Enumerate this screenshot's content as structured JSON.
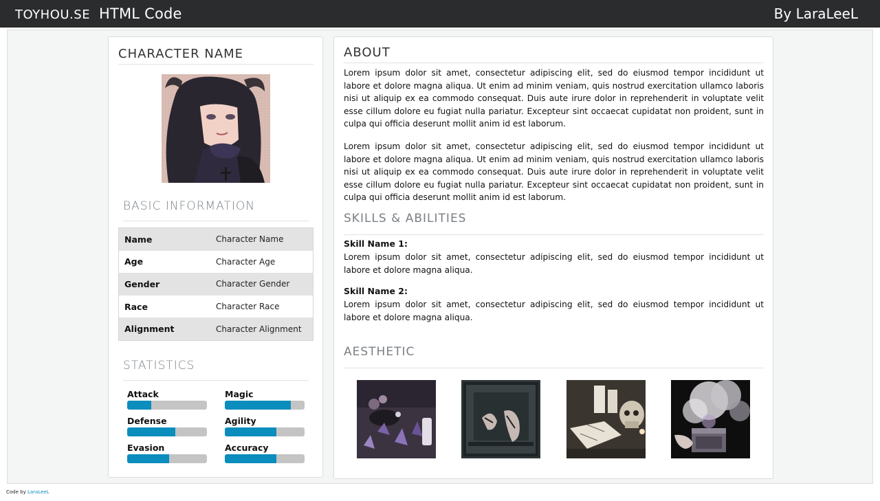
{
  "header": {
    "site": "TOYHOU.SE",
    "title": "HTML Code",
    "byline": "By LaraLeeL"
  },
  "left": {
    "character_name": "CHARACTER NAME",
    "basic_heading": "BASIC INFORMATION",
    "info": [
      {
        "key": "Name",
        "value": "Character Name"
      },
      {
        "key": "Age",
        "value": "Character Age"
      },
      {
        "key": "Gender",
        "value": "Character Gender"
      },
      {
        "key": "Race",
        "value": "Character Race"
      },
      {
        "key": "Alignment",
        "value": "Character Alignment"
      }
    ],
    "stats_heading": "STATISTICS",
    "stats": [
      {
        "label": "Attack",
        "level": 0.3
      },
      {
        "label": "Magic",
        "level": 0.83
      },
      {
        "label": "Defense",
        "level": 0.6
      },
      {
        "label": "Agility",
        "level": 0.65
      },
      {
        "label": "Evasion",
        "level": 0.53
      },
      {
        "label": "Accuracy",
        "level": 0.65
      }
    ]
  },
  "right": {
    "about_heading": "ABOUT",
    "about_p1": "Lorem ipsum dolor sit amet, consectetur adipiscing elit, sed do eiusmod tempor incididunt ut labore et dolore magna aliqua. Ut enim ad minim  veniam, quis nostrud exercitation ullamco laboris nisi ut aliquip ex ea  commodo consequat. Duis aute irure dolor in reprehenderit in voluptate  velit esse cillum dolore eu fugiat nulla pariatur. Excepteur sint  occaecat cupidatat non proident, sunt in culpa qui officia deserunt  mollit anim id est laborum.",
    "about_p2": "Lorem ipsum dolor sit amet, consectetur adipiscing elit, sed do eiusmod tempor incididunt ut labore et dolore magna aliqua. Ut enim ad minim   veniam, quis nostrud exercitation ullamco laboris nisi ut aliquip ex ea   commodo consequat. Duis aute irure dolor in reprehenderit in voluptate velit esse cillum dolore eu fugiat nulla pariatur. Excepteur sint occaecat cupidatat non proident, sunt in culpa qui officia deserunt   mollit anim id est laborum.",
    "skills_heading": "SKILLS & ABILITIES",
    "skills": [
      {
        "name": "Skill Name 1:",
        "text": "Lorem ipsum dolor sit amet, consectetur adipiscing elit, sed do eiusmod  tempor incididunt ut labore et dolore magna aliqua."
      },
      {
        "name": "Skill Name 2:",
        "text": "Lorem ipsum dolor sit amet, consectetur adipiscing elit, sed do eiusmod  tempor incididunt ut labore et dolore magna aliqua."
      }
    ],
    "aesthetic_heading": "AESTHETIC"
  },
  "footer": {
    "prefix": "Code by",
    "author_link": "LaraLeeL"
  },
  "colors": {
    "accent": "#0b8dbd",
    "topbar": "#2b2c2e",
    "row_shade": "#e3e3e3"
  }
}
